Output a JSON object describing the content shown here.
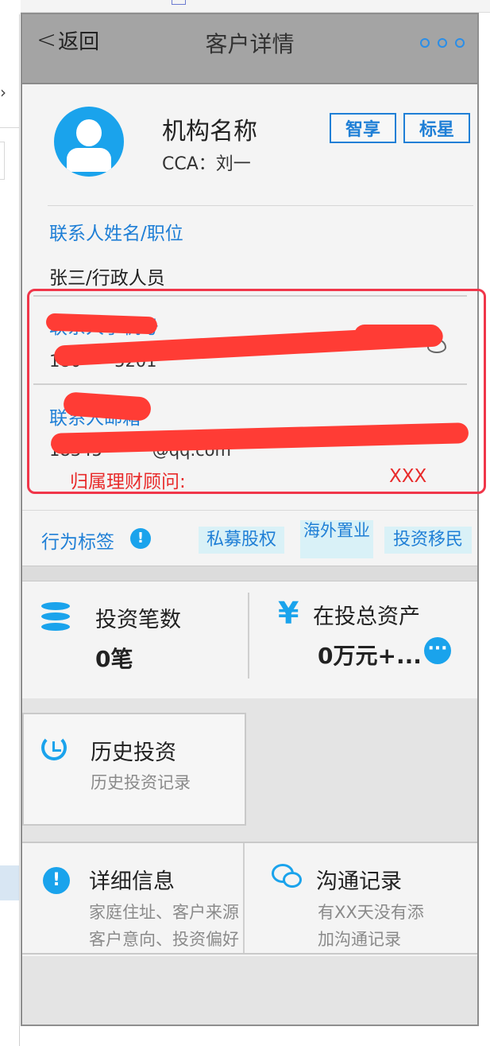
{
  "nav": {
    "back_label": "返回",
    "back_icon": "chevron-left-icon",
    "title": "客户详情",
    "more_icon": "more-dots-icon"
  },
  "profile": {
    "org_name": "机构名称",
    "cca": "CCA：刘一",
    "tags": [
      "智享",
      "标星"
    ],
    "accent_color": "#1f7fd6"
  },
  "contact": {
    "name_label": "联系人姓名/职位",
    "name_value": "张三/行政人员",
    "phone_label": "联系人手机号",
    "phone_value": "180****5201",
    "email_label": "联系人邮箱",
    "email_value": "18345******@qq.com",
    "advisor_label": "归属理财顾问:",
    "advisor_value": "XXX"
  },
  "behavior": {
    "label": "行为标签",
    "chips": [
      "私募股权",
      "海外置业",
      "投资移民"
    ]
  },
  "stats": {
    "count_label": "投资笔数",
    "count_value": "0笔",
    "assets_label": "在投总资产",
    "assets_value": "0万元+..."
  },
  "cards": {
    "history_title": "历史投资",
    "history_sub": "历史投资记录",
    "detail_title": "详细信息",
    "detail_sub_1": "家庭住址、客户来源",
    "detail_sub_2": "客户意向、投资偏好",
    "comm_title": "沟通记录",
    "comm_sub_1": "有XX天没有添",
    "comm_sub_2": "加沟通记录"
  },
  "colors": {
    "primary_blue": "#1aa3ec",
    "highlight_red": "#f0364a",
    "nav_gray": "#a4a4a4"
  }
}
